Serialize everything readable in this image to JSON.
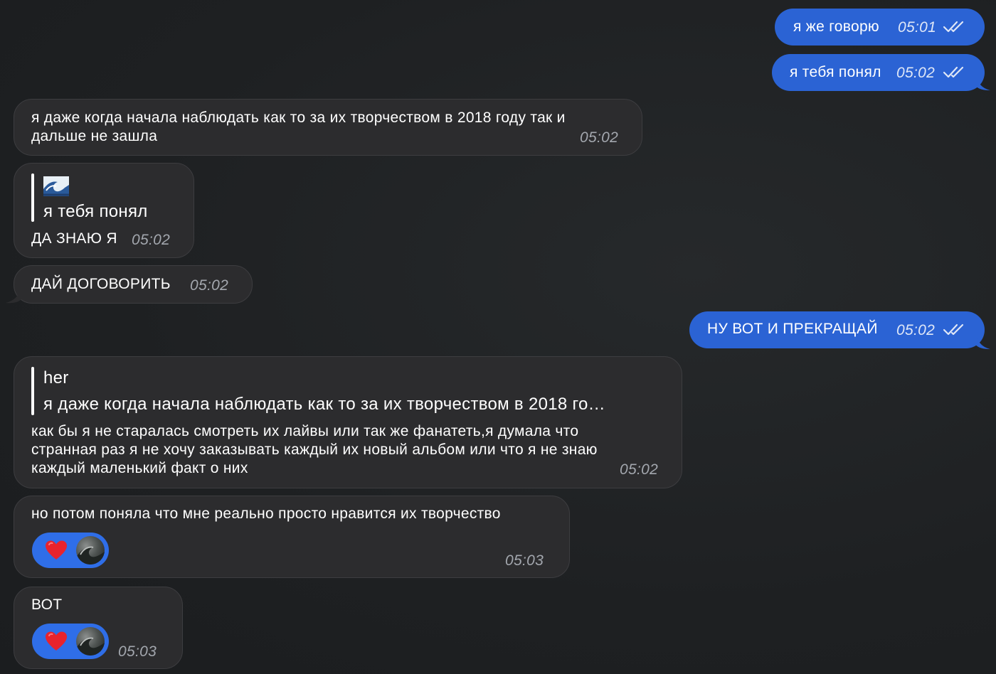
{
  "colors": {
    "background": "#1f2123",
    "incoming_bubble": "#2c2c2e",
    "outgoing_bubble": "#2b63d4",
    "reaction_pill": "#2f6ee8",
    "timestamp_incoming": "#a3a7ae"
  },
  "messages": [
    {
      "direction": "outgoing",
      "text": "я же говорю",
      "time": "05:01",
      "status": "read"
    },
    {
      "direction": "outgoing",
      "text": "я тебя понял",
      "time": "05:02",
      "status": "read"
    },
    {
      "direction": "incoming",
      "text_lines": [
        "я даже когда начала наблюдать как то за их творчеством в 2018 году так и",
        "дальше не зашла"
      ],
      "time": "05:02"
    },
    {
      "direction": "incoming",
      "reply": {
        "sender_icon": "wave-emoji-icon",
        "text": "я тебя понял"
      },
      "text": "ДА ЗНАЮ Я",
      "time": "05:02"
    },
    {
      "direction": "incoming",
      "text": "ДАЙ ДОГОВОРИТЬ",
      "time": "05:02"
    },
    {
      "direction": "outgoing",
      "text": "НУ ВОТ И ПРЕКРАЩАЙ",
      "time": "05:02",
      "status": "read"
    },
    {
      "direction": "incoming",
      "reply": {
        "sender": "her",
        "text": "я даже когда начала наблюдать как то за их творчеством в 2018 го…"
      },
      "text_lines": [
        "как бы я не старалась смотреть их лайвы или так же фанатеть,я думала что",
        "странная раз я не хочу заказывать каждый их новый альбом или что я не знаю",
        "каждый маленький факт о них"
      ],
      "time": "05:02"
    },
    {
      "direction": "incoming",
      "text": "но потом поняла что мне реально просто нравится их творчество",
      "reaction": {
        "emoji": "heart-icon"
      },
      "time": "05:03"
    },
    {
      "direction": "incoming",
      "text": "ВОТ",
      "reaction": {
        "emoji": "heart-icon"
      },
      "time": "05:03"
    }
  ]
}
